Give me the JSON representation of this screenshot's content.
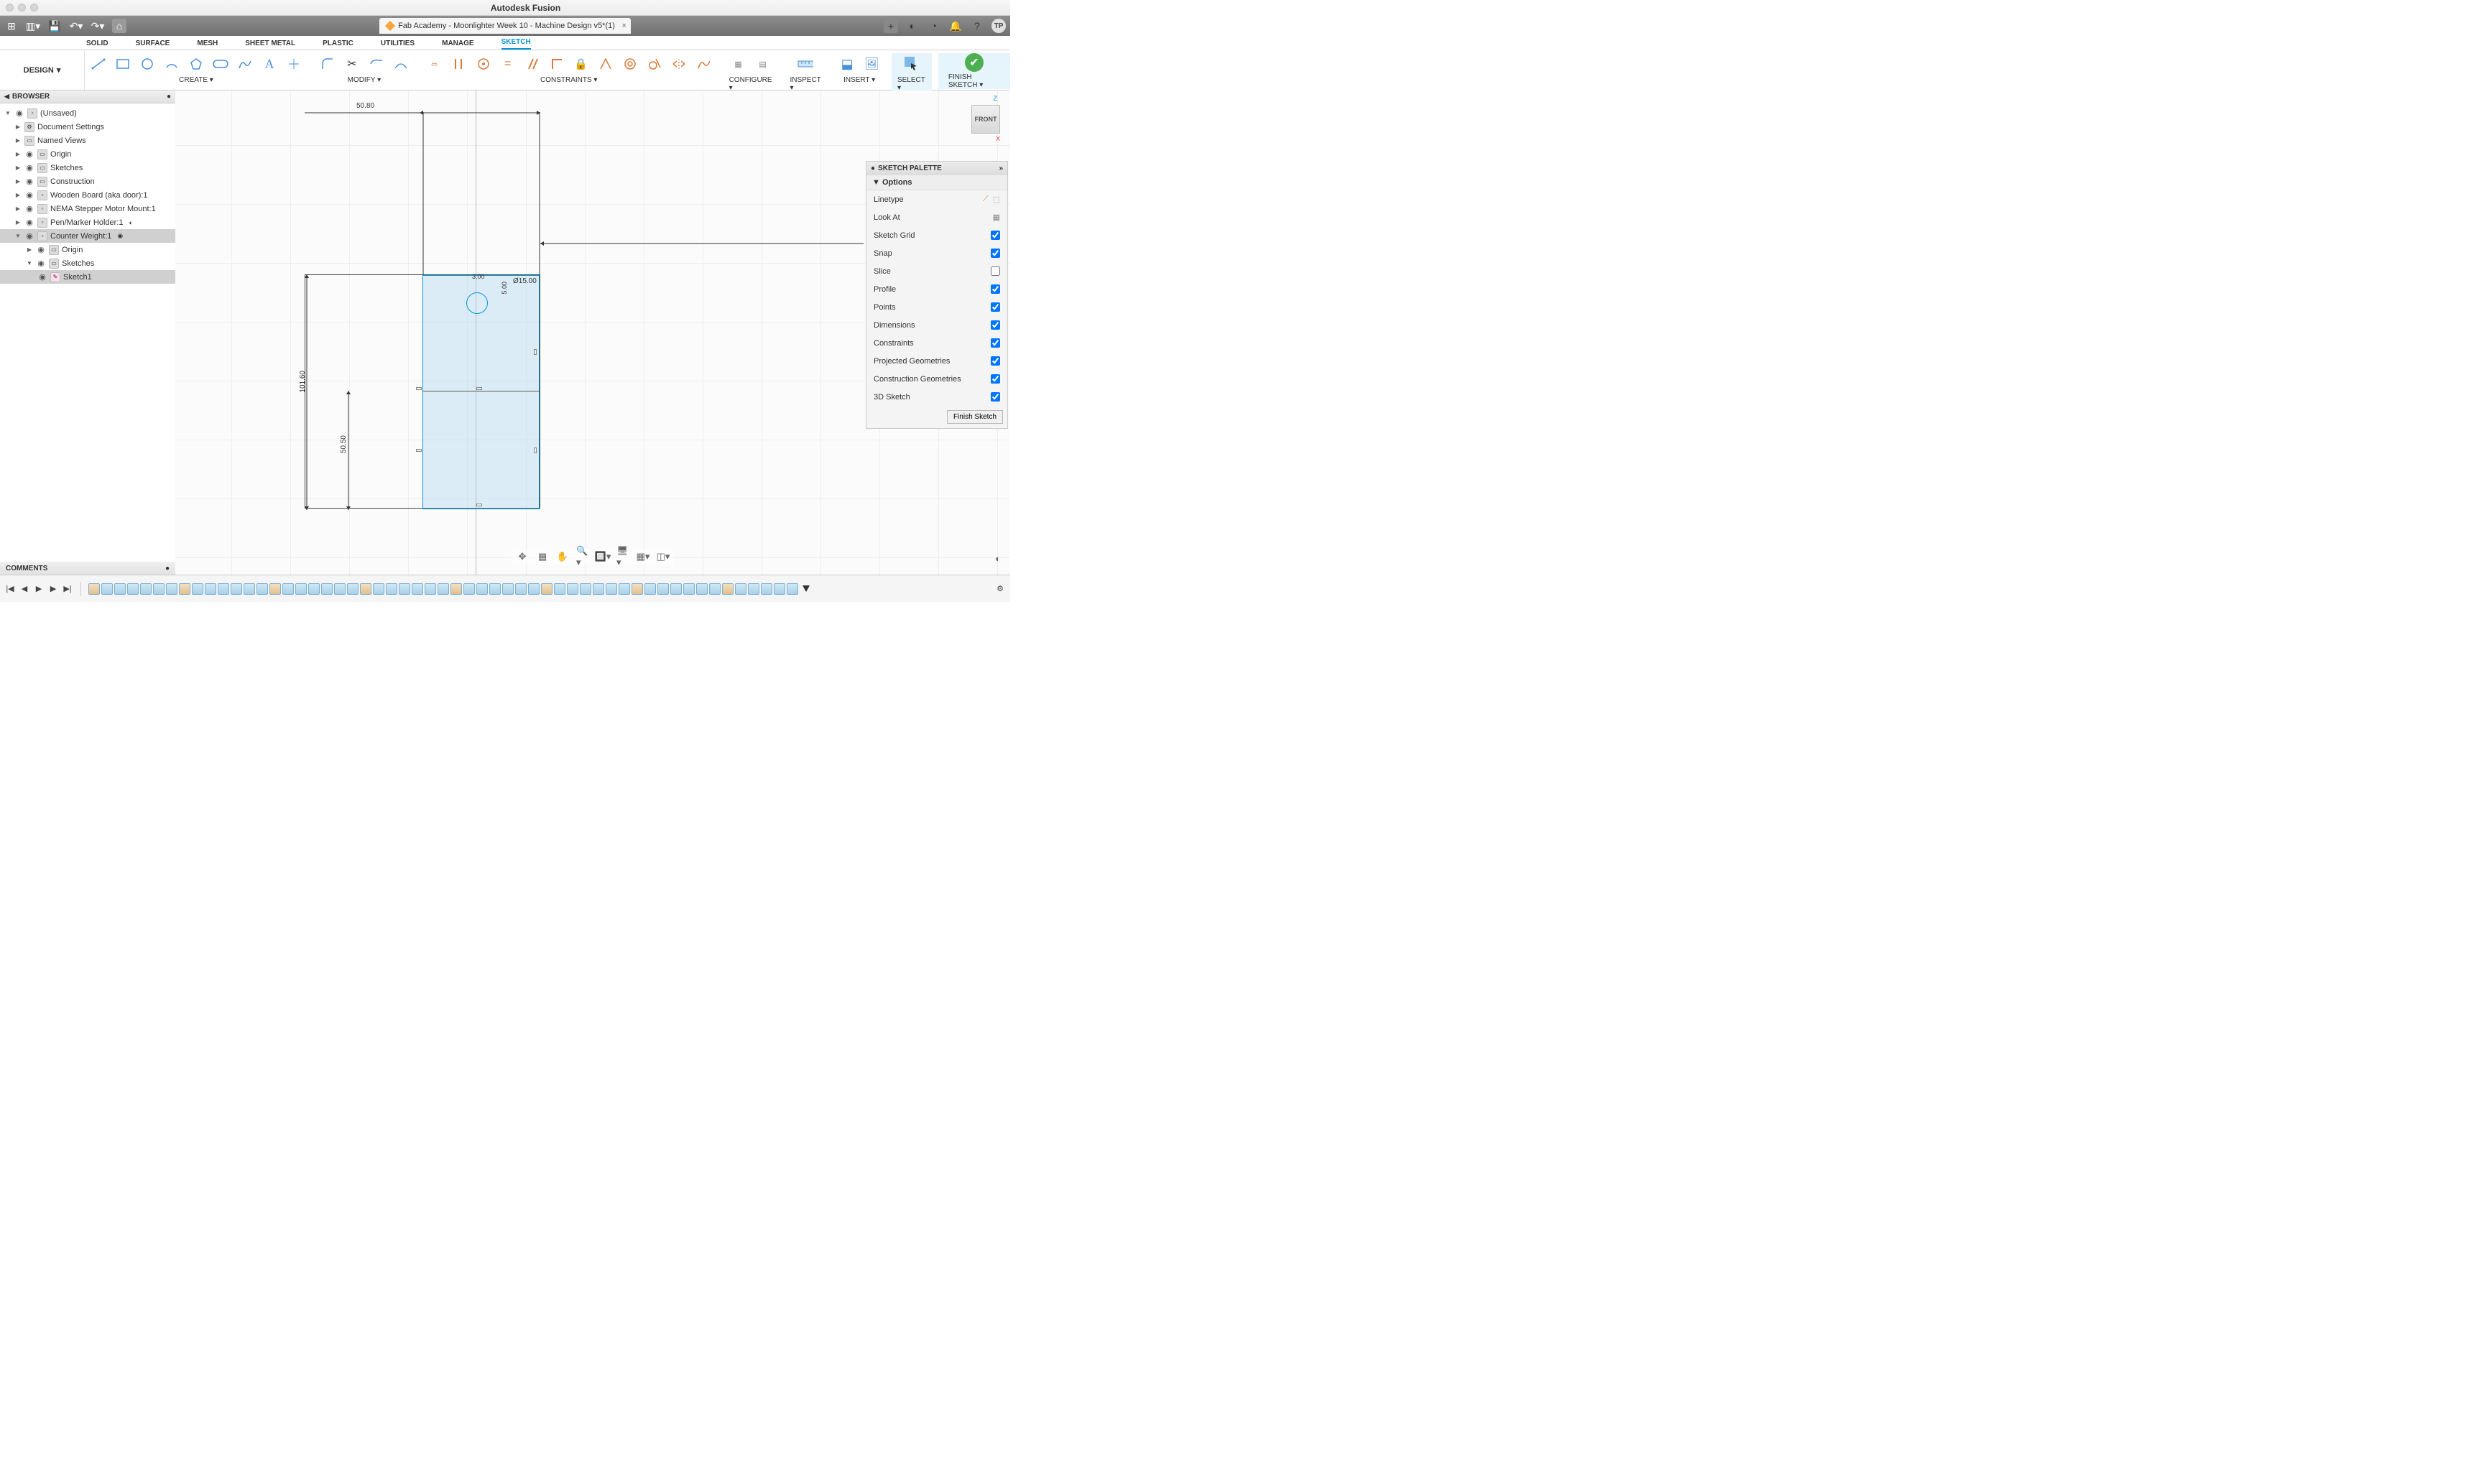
{
  "app_title": "Autodesk Fusion",
  "file_tab": "Fab Academy - Moonlighter Week 10 - Machine Design v5*(1)",
  "avatar": "TP",
  "design_button": "DESIGN",
  "ws_tabs": [
    "SOLID",
    "SURFACE",
    "MESH",
    "SHEET METAL",
    "PLASTIC",
    "UTILITIES",
    "MANAGE",
    "SKETCH"
  ],
  "ws_active": 7,
  "ribbon_groups": {
    "create": "CREATE",
    "modify": "MODIFY",
    "constraints": "CONSTRAINTS",
    "configure": "CONFIGURE",
    "inspect": "INSPECT",
    "insert": "INSERT",
    "select": "SELECT",
    "finish": "FINISH SKETCH"
  },
  "browser_title": "BROWSER",
  "tree": {
    "root": "(Unsaved)",
    "items": [
      "Document Settings",
      "Named Views",
      "Origin",
      "Sketches",
      "Construction",
      "Wooden Board (aka door):1",
      "NEMA Stepper Motor Mount:1",
      "Pen/Marker Holder:1",
      "Counter Weight:1"
    ],
    "sub_origin": "Origin",
    "sub_sketches": "Sketches",
    "sketch1": "Sketch1"
  },
  "comments": "COMMENTS",
  "viewcube_face": "FRONT",
  "axis_z": "Z",
  "axis_x": "X",
  "dims": {
    "top": "50.80",
    "left_h": "101.60",
    "half_h": "50.50",
    "small_a": "3.00",
    "small_b": "5.00",
    "dia": "Ø15.00"
  },
  "palette": {
    "title": "SKETCH PALETTE",
    "options_hd": "Options",
    "rows": [
      {
        "label": "Linetype",
        "type": "icons"
      },
      {
        "label": "Look At",
        "type": "icon"
      },
      {
        "label": "Sketch Grid",
        "type": "check",
        "checked": true
      },
      {
        "label": "Snap",
        "type": "check",
        "checked": true
      },
      {
        "label": "Slice",
        "type": "check",
        "checked": false
      },
      {
        "label": "Profile",
        "type": "check",
        "checked": true
      },
      {
        "label": "Points",
        "type": "check",
        "checked": true
      },
      {
        "label": "Dimensions",
        "type": "check",
        "checked": true
      },
      {
        "label": "Constraints",
        "type": "check",
        "checked": true
      },
      {
        "label": "Projected Geometries",
        "type": "check",
        "checked": true
      },
      {
        "label": "Construction Geometries",
        "type": "check",
        "checked": true
      },
      {
        "label": "3D Sketch",
        "type": "check",
        "checked": true
      }
    ],
    "finish": "Finish Sketch"
  }
}
